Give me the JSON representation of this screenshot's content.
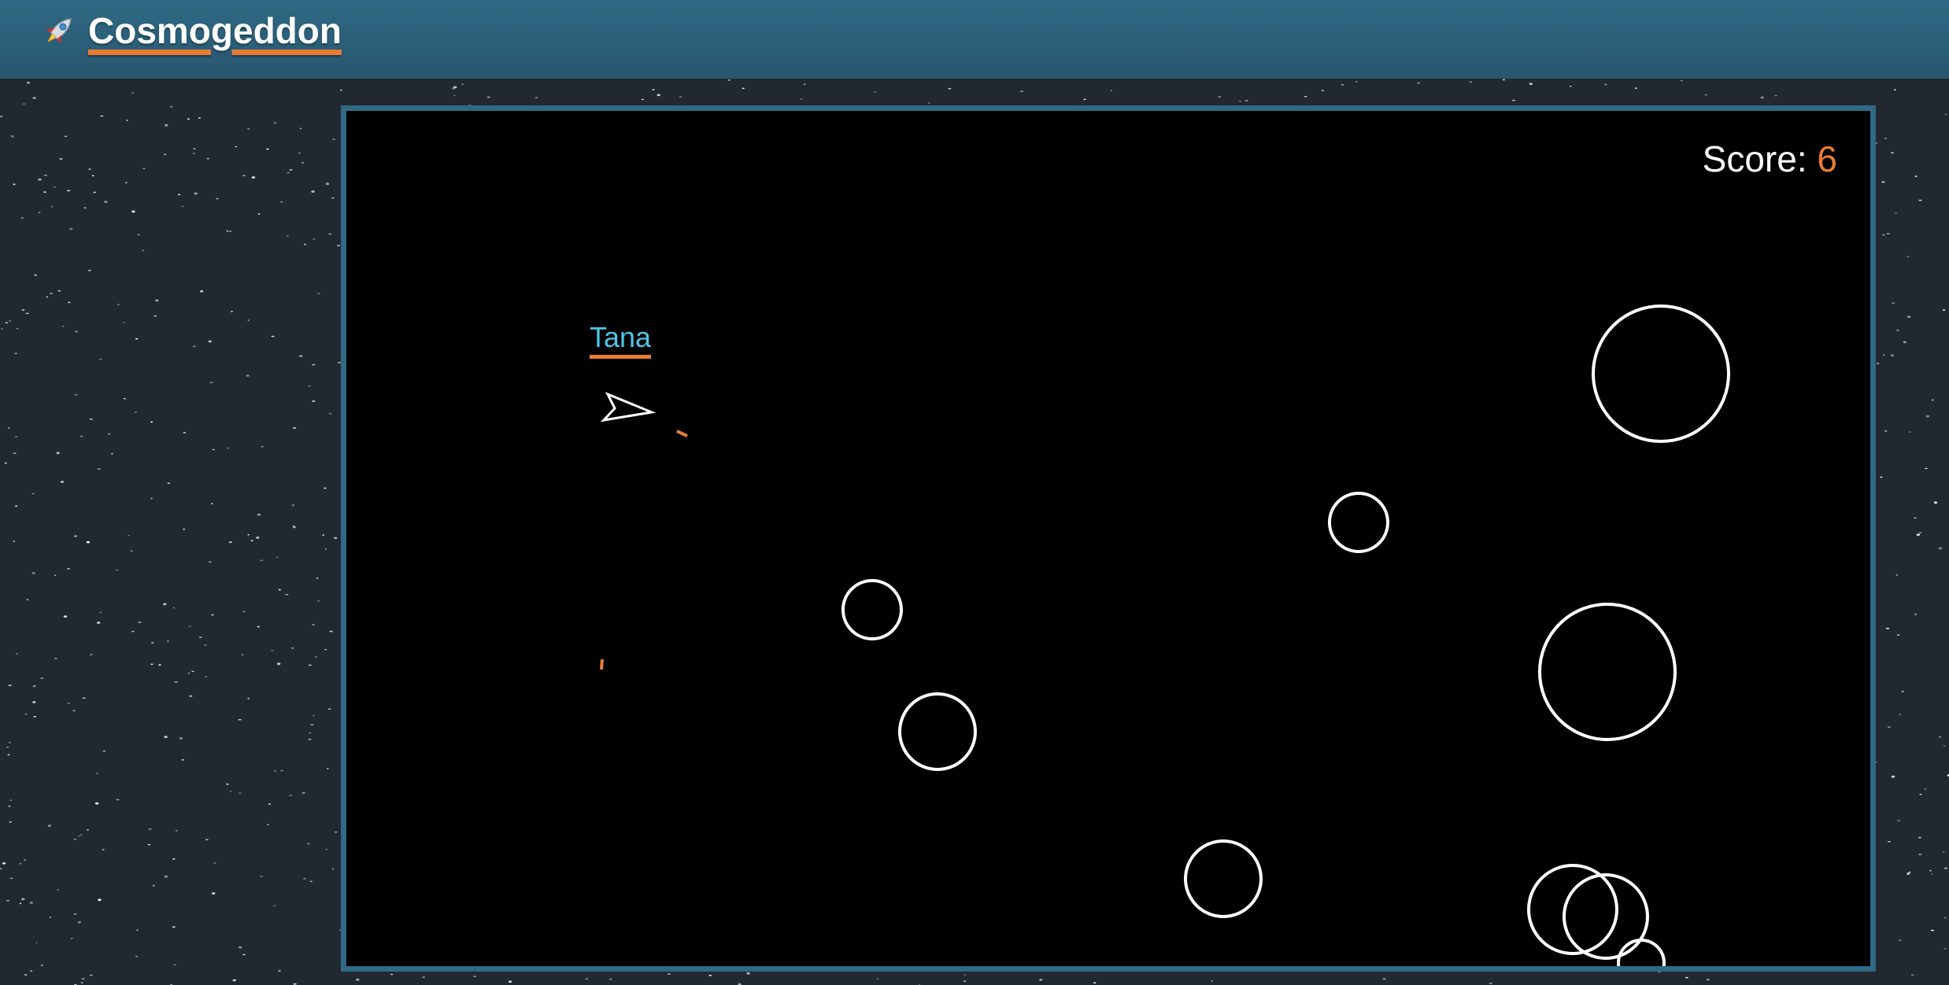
{
  "header": {
    "title": "Cosmogeddon",
    "icon": "rocket-icon"
  },
  "game": {
    "score_label": "Score: ",
    "score_value": "6",
    "player": {
      "name": "Tana",
      "ship_icon": "ship-arrow-icon"
    }
  },
  "colors": {
    "header_bg": "#2f6985",
    "accent": "#e87c34",
    "player_name": "#4fc3e8",
    "asteroid_stroke": "#ffffff",
    "bullet": "#e87c34"
  }
}
